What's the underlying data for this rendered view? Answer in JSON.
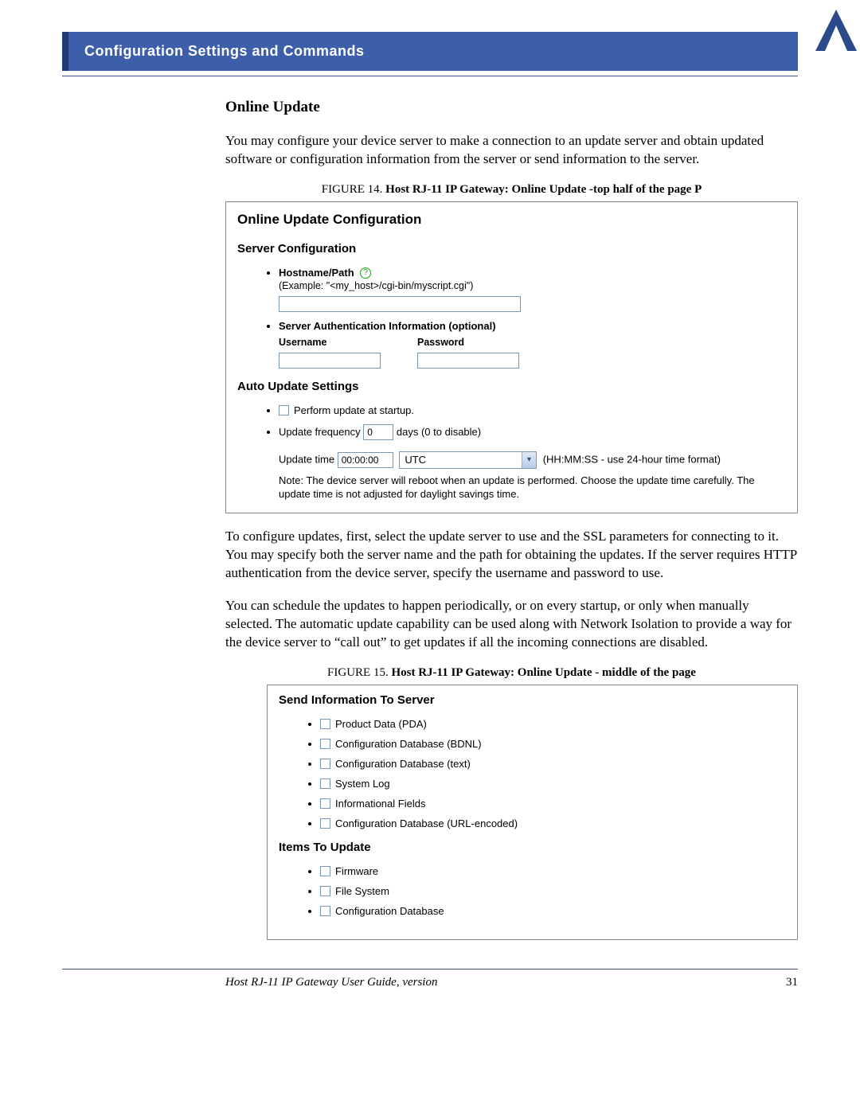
{
  "header": {
    "title": "Configuration Settings and Commands"
  },
  "section_heading": "Online Update",
  "para1": "You may configure your device server to make a connection to an update server and obtain updated software or configuration information from the server or send information to the server.",
  "fig14": {
    "label": "FIGURE 14. ",
    "title": "Host RJ-11 IP Gateway: Online Update -top half of the page P"
  },
  "screenshot1": {
    "title": "Online Update Configuration",
    "server_config_heading": "Server Configuration",
    "hostname_label": "Hostname/Path",
    "hostname_example": "(Example: \"<my_host>/cgi-bin/myscript.cgi\")",
    "auth_heading": "Server Authentication Information (optional)",
    "username_label": "Username",
    "password_label": "Password",
    "auto_heading": "Auto Update Settings",
    "startup_label": "Perform update at startup.",
    "freq_label_pre": "Update frequency",
    "freq_value": "0",
    "freq_label_post": "days (0 to disable)",
    "update_time_label": "Update time",
    "update_time_value": "00:00:00",
    "tz_value": "UTC",
    "tz_format_hint": "(HH:MM:SS - use 24-hour time format)",
    "note": "Note: The device server will reboot when an update is performed. Choose the update time carefully. The update time is not adjusted for daylight savings time."
  },
  "para2": "To configure updates, first, select the update server to use and the SSL parameters for connecting to it. You may specify both the server name and the path for obtaining the updates. If the server requires HTTP authentication from the device server, specify the username and password to use.",
  "para3": "You can schedule the updates to happen periodically, or on every startup, or only when manually selected. The automatic update capability can be used along with Network Isolation to provide a way for the device server to “call out” to get updates if all the incoming connections are disabled.",
  "fig15": {
    "label": "FIGURE 15. ",
    "title": "Host RJ-11 IP Gateway: Online Update - middle of the page"
  },
  "screenshot2": {
    "send_heading": "Send Information To Server",
    "send_items": [
      "Product Data (PDA)",
      "Configuration Database (BDNL)",
      "Configuration Database (text)",
      "System Log",
      "Informational Fields",
      "Configuration Database (URL-encoded)"
    ],
    "update_heading": "Items To Update",
    "update_items": [
      "Firmware",
      "File System",
      "Configuration Database"
    ]
  },
  "footer": {
    "guide": "Host RJ-11 IP Gateway User Guide, version",
    "page": "31"
  }
}
